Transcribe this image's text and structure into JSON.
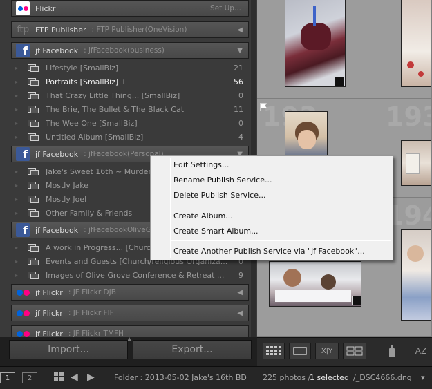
{
  "publish_services": [
    {
      "id": "flickr-top",
      "logo": "flickr-logo-white",
      "name": "Flickr",
      "subtitle": "",
      "action": "Set Up..."
    },
    {
      "id": "ftp",
      "logo": "ftp-logo",
      "name": "FTP Publisher",
      "subtitle": ": FTP Publisher(OneVision)",
      "state": "collapsed"
    },
    {
      "id": "fb-business",
      "logo": "facebook-logo",
      "name": "jf Facebook",
      "subtitle": ": jfFacebook(business)",
      "state": "expanded",
      "albums": [
        {
          "label": "Lifestyle [SmallBiz]",
          "count": "21"
        },
        {
          "label": "Portraits [SmallBiz]  +",
          "count": "56",
          "selected": true
        },
        {
          "label": "That Crazy Little Thing... [SmallBiz]",
          "count": "0"
        },
        {
          "label": "The Brie, The Bullet & The Black Cat",
          "count": "11"
        },
        {
          "label": "The Wee One [SmallBiz]",
          "count": "0"
        },
        {
          "label": "Untitled Album [SmallBiz]",
          "count": "4"
        }
      ]
    },
    {
      "id": "fb-personal",
      "logo": "facebook-logo",
      "name": "jf Facebook",
      "subtitle": ": jfFacebook(Personal)",
      "state": "expanded",
      "albums": [
        {
          "label": "Jake's Sweet 16th ~ Murder M",
          "count": ""
        },
        {
          "label": "Mostly Jake",
          "count": ""
        },
        {
          "label": "Mostly Joel",
          "count": ""
        },
        {
          "label": "Other Family & Friends",
          "count": ""
        }
      ]
    },
    {
      "id": "fb-olive",
      "logo": "facebook-logo",
      "name": "jf Facebook",
      "subtitle": ": jfFacebookOliveG",
      "state": "expanded",
      "albums": [
        {
          "label": "A work in Progress... [Church",
          "count": ""
        },
        {
          "label": "Events and Guests [Church/religious Organiza...",
          "count": "0"
        },
        {
          "label": "Images of Olive Grove Conference & Retreat ...",
          "count": "9"
        }
      ]
    },
    {
      "id": "flickr-djb",
      "logo": "flickr-logo",
      "name": "jf Flickr",
      "subtitle": ": JF Flickr DJB",
      "state": "collapsed"
    },
    {
      "id": "flickr-fif",
      "logo": "flickr-logo",
      "name": "jf Flickr",
      "subtitle": ": JF Flickr FIF",
      "state": "collapsed"
    },
    {
      "id": "flickr-tmfh",
      "logo": "flickr-logo",
      "name": "jf Flickr",
      "subtitle": ": JF Flickr TMFH",
      "state": "collapsed"
    }
  ],
  "buttons": {
    "import": "Import...",
    "export": "Export..."
  },
  "context_menu": {
    "items": [
      "Edit Settings...",
      "Rename Publish Service...",
      "Delete Publish Service...",
      "Create Album...",
      "Create Smart Album...",
      "Create Another Publish Service via \"jf Facebook\"..."
    ]
  },
  "grid": {
    "cell_numbers": [
      "193",
      "193",
      "194",
      "194"
    ]
  },
  "toolbar": {
    "compare_label": "X|Y",
    "sort_label": "AZ"
  },
  "status_bar": {
    "monitor_1": "1",
    "monitor_2": "2",
    "folder": "Folder : 2013-05-02 Jake's 16th BD",
    "photos": "225 photos /",
    "selected": "1 selected",
    "filename": "/_DSC4666.dng",
    "dropdown": "▾"
  },
  "colors": {
    "facebook": "#3b5998",
    "flickr_blue": "#0063dc",
    "flickr_pink": "#ff0084",
    "panel": "#3a3a3a"
  }
}
